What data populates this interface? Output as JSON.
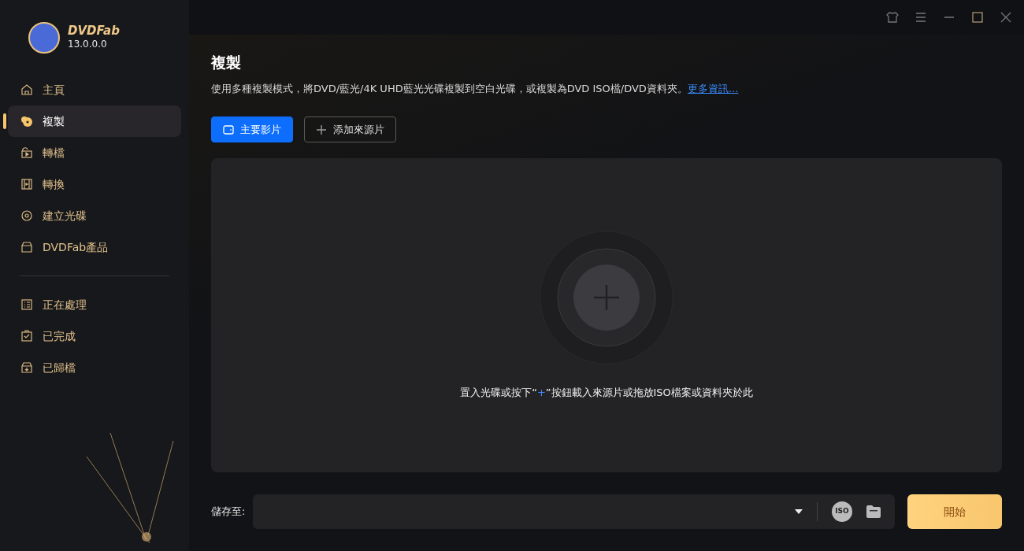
{
  "app": {
    "name": "DVDFab",
    "version": "13.0.0.0"
  },
  "sidebar": {
    "groups": [
      {
        "items": [
          {
            "label": "主頁",
            "selected": false
          },
          {
            "label": "複製",
            "selected": true
          },
          {
            "label": "轉檔",
            "selected": false
          },
          {
            "label": "轉換",
            "selected": false
          },
          {
            "label": "建立光碟",
            "selected": false
          },
          {
            "label": "DVDFab產品",
            "selected": false
          }
        ]
      },
      {
        "items": [
          {
            "label": "正在處理",
            "selected": false
          },
          {
            "label": "已完成",
            "selected": false
          },
          {
            "label": "已歸檔",
            "selected": false
          }
        ]
      }
    ]
  },
  "page": {
    "title": "複製",
    "description": "使用多種複製模式，將DVD/藍光/4K UHD藍光光碟複製到空白光碟，或複製為DVD ISO檔/DVD資料夾。",
    "more_link": "更多資訊...",
    "mode_buttons": [
      {
        "label": "主要影片",
        "selected": true
      },
      {
        "label": "添加來源片",
        "selected": false
      }
    ],
    "drop_hint": {
      "before": "置入光碟或按下“",
      "plus": "+",
      "after": "”按鈕載入來源片或拖放ISO檔案或資料夾於此"
    }
  },
  "save_bar": {
    "label": "儲存至:",
    "iso_button": "ISO",
    "start_button": "開始"
  }
}
